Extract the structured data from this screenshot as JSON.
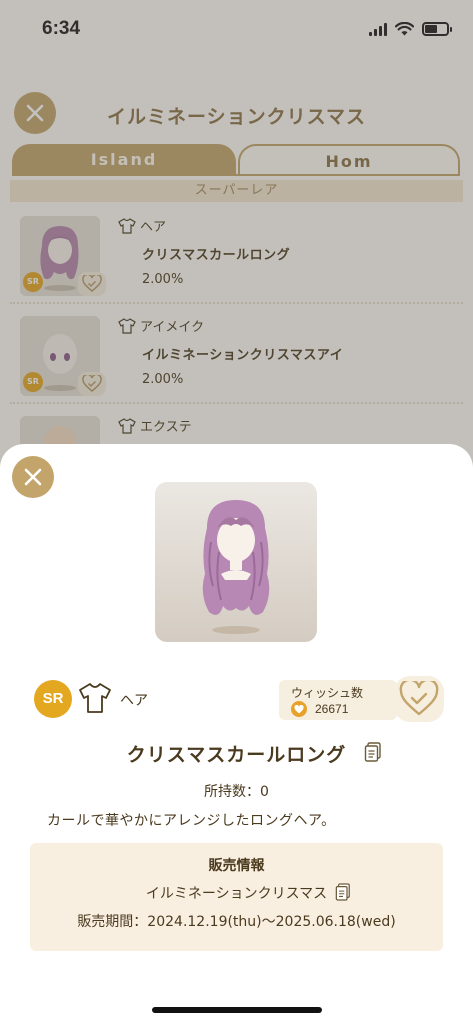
{
  "status_bar": {
    "time": "6:34"
  },
  "gacha": {
    "title": "イルミネーションクリスマス",
    "tabs": [
      "Island",
      "Hom"
    ],
    "rarity_section": "スーパーレア",
    "items": [
      {
        "sr": "SR",
        "category": "ヘア",
        "name": "クリスマスカールロング",
        "rate": "2.00%"
      },
      {
        "sr": "SR",
        "category": "アイメイク",
        "name": "イルミネーションクリスマスアイ",
        "rate": "2.00%"
      },
      {
        "category": "エクステ"
      }
    ]
  },
  "detail": {
    "rarity": "SR",
    "category": "ヘア",
    "wish": {
      "label": "ウィッシュ数",
      "count": "26671"
    },
    "name": "クリスマスカールロング",
    "owned": "所持数：0",
    "description": "カールで華やかにアレンジしたロングヘア。",
    "sales": {
      "heading": "販売情報",
      "event": "イルミネーションクリスマス",
      "period": "販売期間：2024.12.19(thu)〜2025.06.18(wed)"
    }
  },
  "colors": {
    "accent": "#c3a46a",
    "sr_badge": "#e4a720",
    "text": "#4a3a1e",
    "sales_bg": "#f9efe1"
  }
}
